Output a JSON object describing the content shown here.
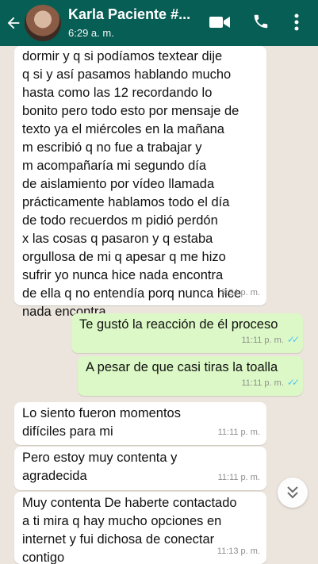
{
  "header": {
    "contact_name": "Karla Paciente #...",
    "status": "6:29 a. m."
  },
  "messages": [
    {
      "direction": "incoming",
      "text": "dormir y q si podíamos textear dije\nq si y así pasamos hablando mucho\nhasta como las 12 recordando lo\nbonito pero todo esto por mensaje de\ntexto ya el miércoles en la mañana\nm escribió q no fue a trabajar y\nm acompañaría mi segundo día\nde aislamiento por vídeo llamada\nprácticamente hablamos todo el día\nde todo recuerdos m pidió perdón\nx las cosas q pasaron y q estaba\norgullosa de mi q apesar q me hizo\nsufrir yo nunca hice nada encontra\nde ella q no entendía porq nunca hice\nnada encontra .",
      "time": "9:34 p. m."
    },
    {
      "direction": "outgoing",
      "text": "Te gustó la reacción de él proceso",
      "time": "11:11 p. m.",
      "status_icon": "double-check-read"
    },
    {
      "direction": "outgoing",
      "text": "A pesar de que casi tiras la toalla",
      "time": "11:11 p. m.",
      "status_icon": "double-check-read"
    },
    {
      "direction": "incoming",
      "text": "Lo siento fueron momentos\ndifíciles para mi",
      "time": "11:11 p. m."
    },
    {
      "direction": "incoming",
      "text": "Pero estoy muy contenta y\nagradecida",
      "time": "11:11 p. m."
    },
    {
      "direction": "incoming",
      "text": "Muy contenta De haberte contactado\na ti mira q hay mucho opciones en\ninternet y fui dichosa de conectar\ncontigo",
      "time": "11:13 p. m."
    }
  ],
  "colors": {
    "header": "#075e54",
    "chat_background": "#ece5dd",
    "incoming_bubble": "#ffffff",
    "outgoing_bubble": "#dcf8c6",
    "read_ticks": "#4fc3f7"
  },
  "icons": [
    "back-arrow-icon",
    "video-call-icon",
    "phone-icon",
    "more-options-icon",
    "scroll-down-icon"
  ]
}
